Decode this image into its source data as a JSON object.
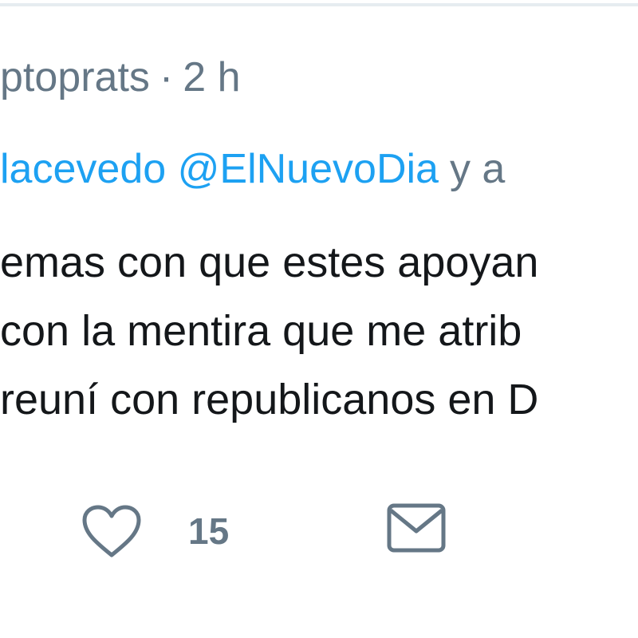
{
  "tweet": {
    "author_handle": "ptoprats",
    "separator": "·",
    "time": "2 h",
    "reply_mention_1": "lacevedo",
    "reply_mention_2": "@ElNuevoDia",
    "reply_rest": "y a",
    "body_lines": [
      "emas con que estes apoyan",
      "con la mentira que me atrib",
      "reuní con republicanos en D"
    ]
  },
  "actions": {
    "like_icon": "heart-icon",
    "like_count": "15",
    "dm_icon": "envelope-icon"
  },
  "colors": {
    "link": "#1da1f2",
    "secondary_text": "#657786",
    "primary_text": "#14171a",
    "divider": "#e6ecf0"
  }
}
